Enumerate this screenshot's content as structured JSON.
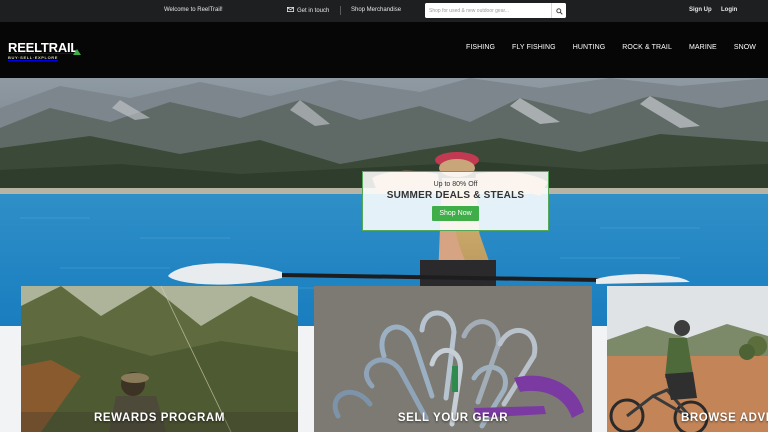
{
  "topbar": {
    "welcome": "Welcome to ReelTrail!",
    "contact_label": "Get in touch",
    "merch_label": "Shop Merchandise",
    "search_placeholder": "Shop for used & new outdoor gear...",
    "signup_label": "Sign Up",
    "login_label": "Login"
  },
  "brand": {
    "name": "REELTRAIL",
    "tagline": "BUY·SELL·EXPLORE",
    "accent": "#3fae49"
  },
  "nav": {
    "items": [
      {
        "label": "FISHING"
      },
      {
        "label": "FLY FISHING"
      },
      {
        "label": "HUNTING"
      },
      {
        "label": "ROCK & TRAIL"
      },
      {
        "label": "MARINE"
      },
      {
        "label": "SNOW"
      }
    ]
  },
  "promo": {
    "subtitle": "Up to 80% Off",
    "title": "SUMMER DEALS & STEALS",
    "cta": "Shop Now"
  },
  "cards": [
    {
      "label": "REWARDS PROGRAM"
    },
    {
      "label": "SELL YOUR GEAR"
    },
    {
      "label": "BROWSE ADVEN"
    }
  ],
  "icons": {
    "contact": "envelope-icon",
    "search": "magnifier-icon",
    "logo_mark": "mountain-triangle-icon"
  }
}
